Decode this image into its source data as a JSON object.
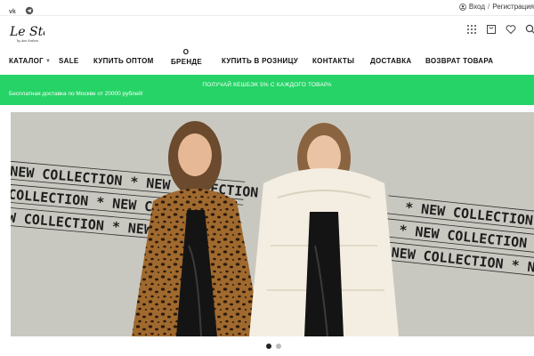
{
  "topbar": {
    "social": [
      {
        "name": "vk-icon"
      },
      {
        "name": "telegram-icon"
      }
    ],
    "login_label": "Вход",
    "separator": "/",
    "register_label": "Регистрация"
  },
  "header": {
    "logo_text": "Le Stay",
    "logo_sub": "by Ann Sedova",
    "icons": [
      "catalog-grid-icon",
      "cart-icon",
      "heart-icon",
      "search-icon"
    ]
  },
  "nav": {
    "items": [
      {
        "label": "КАТАЛОГ",
        "has_dropdown": true
      },
      {
        "label": "SALE"
      },
      {
        "label": "КУПИТЬ ОПТОМ"
      },
      {
        "label_top": "О",
        "label_bottom": "БРЕНДЕ"
      },
      {
        "label": "КУПИТЬ В РОЗНИЦУ"
      },
      {
        "label": "КОНТАКТЫ"
      },
      {
        "label": "ДОСТАВКА"
      },
      {
        "label": "ВОЗВРАТ ТОВАРА"
      }
    ]
  },
  "promo": {
    "cashback": "ПОЛУЧАЙ КЕШБЭК 5% С КАЖДОГО ТОВАРА",
    "delivery": "Бесплатная доставка по Москве от 20000 рублей!",
    "background": "#25d366"
  },
  "hero": {
    "banner_text": "NEW COLLECTION",
    "separator": "*",
    "background": "#c9c8c0"
  },
  "slider": {
    "total": 2,
    "active": 1
  }
}
